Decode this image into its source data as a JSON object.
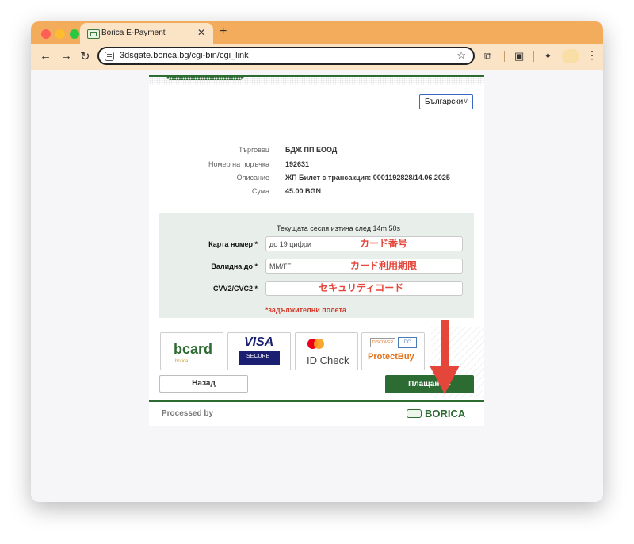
{
  "browser": {
    "tab_title": "Borica E-Payment",
    "tab_close": "✕",
    "new_tab": "+",
    "url": "3dsgate.borica.bg/cgi-bin/cgi_link"
  },
  "page": {
    "language": "Български",
    "info": [
      {
        "label": "Търговец",
        "value": "БДЖ ПП ЕООД"
      },
      {
        "label": "Номер на поръчка",
        "value": "192631"
      },
      {
        "label": "Описание",
        "value": "ЖП Билет с трансакция: 0001192828/14.06.2025"
      },
      {
        "label": "Сума",
        "value": "45.00 BGN"
      }
    ],
    "timer": "Текущата сесия изтича след  14m 50s",
    "fields": [
      {
        "label": "Карта номер *",
        "placeholder": "до 19 цифри",
        "annotation": "カード番号"
      },
      {
        "label": "Валидна до *",
        "placeholder": "ММ/ГГ",
        "annotation": "カード利用期限"
      },
      {
        "label": "CVV2/CVC2 *",
        "placeholder": "",
        "annotation": "セキュリティコード"
      }
    ],
    "required_note": "*задължителни полета",
    "logos": {
      "bcard": "bcard",
      "bcard_sub": "borica",
      "visa": "VISA",
      "visa_secure": "SECURE",
      "idcheck": "ID Check",
      "discover": "DISCOVER",
      "diners": "DC",
      "protectbuy": "ProtectBuy"
    },
    "back_label": "Назад",
    "pay_label": "Плащане",
    "footer_processed": "Processed by",
    "footer_brand": "BORICA"
  },
  "colors": {
    "brand_green": "#2c6b32",
    "annotation_red": "#e5463a",
    "tabbar_orange": "#f3ac5c"
  },
  "icons": [
    "back-arrow-icon",
    "forward-arrow-icon",
    "reload-icon",
    "site-settings-icon",
    "bookmark-star-icon",
    "extensions-icon",
    "reading-list-icon",
    "ai-icon",
    "menu-icon",
    "red-down-arrow-annotation"
  ]
}
